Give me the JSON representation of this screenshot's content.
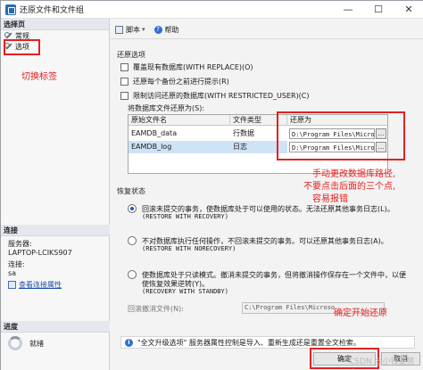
{
  "window": {
    "title": "还原文件和文件组",
    "controls": [
      "—",
      "☐",
      "✕"
    ]
  },
  "left_pane": {
    "select_page_header": "选择页",
    "nav_items": [
      {
        "label": "常规",
        "icon": "wrench-icon"
      },
      {
        "label": "选项",
        "icon": "wrench-icon"
      }
    ],
    "connection": {
      "header": "连接",
      "server_label": "服务器:",
      "server_value": "LAPTOP-LCIKS907",
      "connection_label": "连接:",
      "connection_value": "sa",
      "view_props_link": "查看连接属性"
    },
    "progress": {
      "header": "进度",
      "status": "就绪"
    }
  },
  "toolbar": {
    "script_label": "脚本",
    "help_label": "帮助"
  },
  "restore_options": {
    "title": "还原选项",
    "checkboxes": [
      {
        "label": "覆盖现有数据库(WITH REPLACE)(O)",
        "checked": false
      },
      {
        "label": "还原每个备份之前进行提示(R)",
        "checked": false
      },
      {
        "label": "限制访问还原的数据库(WITH RESTRICTED_USER)(C)",
        "checked": false
      }
    ],
    "file_grid_label": "将数据库文件还原为(S):",
    "columns": [
      "原始文件名",
      "文件类型",
      "还原为"
    ],
    "rows": [
      {
        "name": "EAMDB_data",
        "type": "行数据",
        "restore_as": "D:\\Program Files\\Micro",
        "browse": "..."
      },
      {
        "name": "EAMDB_log",
        "type": "日志",
        "restore_as": "D:\\Program Files\\Microsoft",
        "browse": "..."
      }
    ]
  },
  "recovery_state": {
    "title": "恢复状态",
    "options": [
      {
        "line1": "回滚未提交的事务，使数据库处于可以使用的状态。无法还原其他事务日志(L)。",
        "line2": "(RESTORE WITH RECOVERY)",
        "selected": true
      },
      {
        "line1": "不对数据库执行任何操作，不回滚未提交的事务。可以还原其他事务日志(A)。",
        "line2": "(RESTORE WITH NORECOVERY)",
        "selected": false
      },
      {
        "line1": "使数据库处于只读模式。撤消未提交的事务，但将撤消操作保存在一个文件中，以便",
        "line1b": "使恢复效果逆转(Y)。",
        "line2": "(RECOVERY WITH STANDBY)",
        "selected": false
      }
    ],
    "standby_label": "回滚撤消文件(N):",
    "standby_value": "C:\\Program Files\\Microso"
  },
  "info_message": "\"全文升级选项\" 服务器属性控制是导入、重新生成还是重置全文检索。",
  "buttons": {
    "ok": "确定",
    "cancel": "取消"
  },
  "annotations": {
    "switch_tab": "切换标签",
    "change_path_1": "手动更改数据库路径,",
    "change_path_2": "不要点击后面的三个点,",
    "change_path_3": "容易报错",
    "click_ok": "确定开始还原",
    "watermark": "CSDN @小钱要努力"
  },
  "colors": {
    "annotation_red": "#e32121",
    "link_blue": "#1d4fa8"
  }
}
